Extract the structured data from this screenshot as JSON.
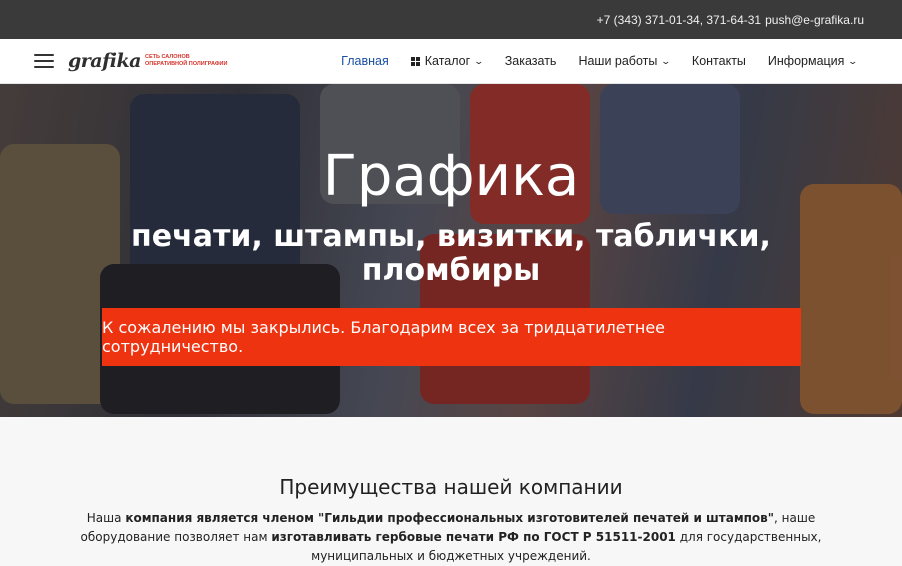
{
  "topbar": {
    "phone": "+7 (343) 371-01-34, 371-64-31",
    "email": "push@e-grafika.ru"
  },
  "logo": {
    "word": "grafika",
    "tag_line1": "СЕТЬ САЛОНОВ",
    "tag_line2": "ОПЕРАТИВНОЙ ПОЛИГРАФИИ"
  },
  "nav": {
    "items": [
      {
        "label": "Главная"
      },
      {
        "label": "Каталог"
      },
      {
        "label": "Заказать"
      },
      {
        "label": "Наши работы"
      },
      {
        "label": "Контакты"
      },
      {
        "label": "Информация"
      }
    ]
  },
  "hero": {
    "title": "Графика",
    "subtitle_line1": "печати, штампы, визитки, таблички,",
    "subtitle_line2": "пломбиры",
    "notice": "К сожалению мы закрылись. Благодарим всех за тридцатилетнее сотрудничество."
  },
  "advantages": {
    "title": "Преимущества нашей компании",
    "p1_a": "Наша ",
    "p1_b": "компания является членом \"Гильдии профессиональных изготовителей печатей и штампов\"",
    "p1_c": ", наше оборудование позволяет нам ",
    "p1_d": "изготавливать гербовые печати РФ по ГОСТ Р 51511-2001",
    "p1_e": " для государственных, муниципальных и бюджетных учреждений."
  },
  "colors": {
    "topbar_bg": "#3a3a3a",
    "accent_nav": "#1a4fa0",
    "notice_bg": "#ee3311",
    "logo_tag": "#d2332a"
  }
}
